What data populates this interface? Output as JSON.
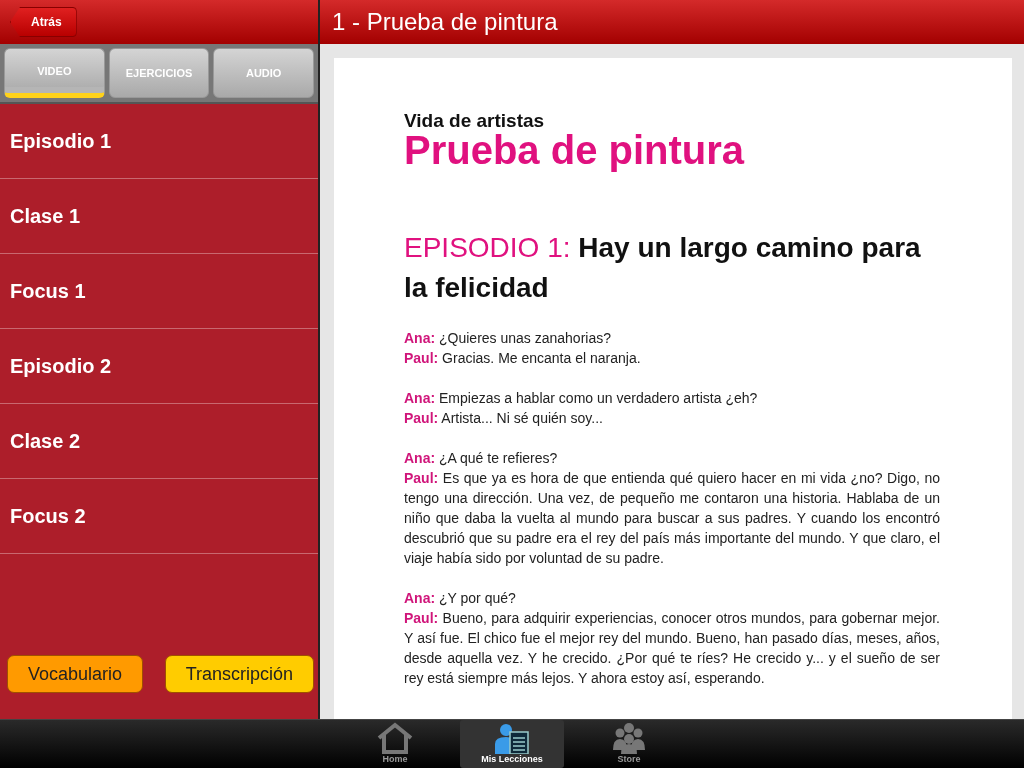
{
  "back_button": "Atrás",
  "title": "1 - Prueba de pintura",
  "tabs": [
    {
      "label": "VIDEO",
      "selected": true
    },
    {
      "label": "EJERCICIOS",
      "selected": false
    },
    {
      "label": "AUDIO",
      "selected": false
    }
  ],
  "lessons": [
    "Episodio 1",
    "Clase 1",
    "Focus 1",
    "Episodio 2",
    "Clase 2",
    "Focus 2"
  ],
  "buttons": [
    {
      "label": "Vocabulario",
      "color": "#ff9a00"
    },
    {
      "label": "Transcripción",
      "color": "#ffcc00"
    }
  ],
  "document": {
    "kicker": "Vida de artistas",
    "heading": "Prueba de pintura",
    "episode_title": "EPISODIO 1: **Hay un largo camino para la felicidad**",
    "exchanges": [
      [
        {
          "speaker": "Ana:",
          "text": "¿Quieres unas zanahorias?"
        },
        {
          "speaker": "Paul:",
          "text": "Gracias. Me encanta el naranja."
        }
      ],
      [
        {
          "speaker": "Ana:",
          "text": "Empiezas a hablar como un verdadero artista ¿eh?"
        },
        {
          "speaker": "Paul:",
          "text": "Artista... Ni sé quién soy..."
        }
      ],
      [
        {
          "speaker": "Ana:",
          "text": "¿A qué te refieres?"
        },
        {
          "speaker": "Paul:",
          "text": "Es que ya es hora de que entienda qué quiero hacer en mi vida ¿no? Digo, no tengo una dirección. Una vez, de pequeño me contaron una historia. Hablaba de un niño que daba la vuelta al mundo para buscar a sus padres. Y cuando los encontró descubrió que su padre era el rey del país más importante del mundo. Y que claro, el viaje había sido por voluntad de su padre."
        }
      ],
      [
        {
          "speaker": "Ana:",
          "text": "¿Y por qué?"
        },
        {
          "speaker": "Paul:",
          "text": "Bueno, para adquirir experiencias, conocer otros mundos, para gobernar mejor. Y así fue. El chico fue el mejor rey del mundo. Bueno, han pasado días, meses, años, desde aquella vez. Y he crecido. ¿Por qué te ríes? He crecido y... y el sueño de ser rey está siempre más lejos. Y ahora estoy así, esperando."
        }
      ]
    ]
  },
  "tab_bar": [
    {
      "label": "Home",
      "kind": "home",
      "selected": false
    },
    {
      "label": "Mis Lecciones",
      "kind": "lessons",
      "selected": true
    },
    {
      "label": "Store",
      "kind": "store",
      "selected": false
    }
  ]
}
